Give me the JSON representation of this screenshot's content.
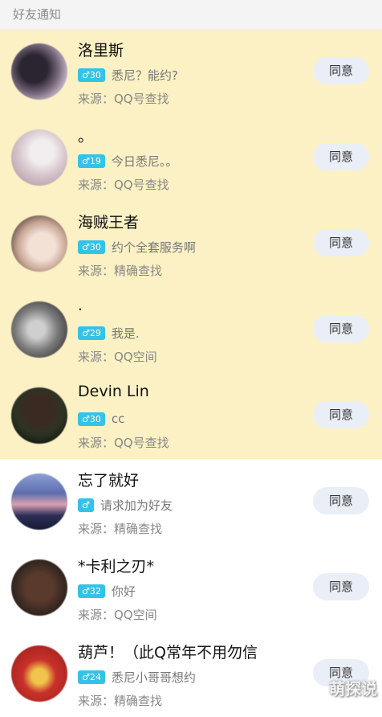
{
  "header": {
    "title": "好友通知"
  },
  "rows": [
    {
      "name": "洛里斯",
      "badge": "♂30",
      "message": "悉尼？能约?",
      "source": "来源：QQ号查找",
      "button": "同意"
    },
    {
      "name": "。",
      "badge": "♂19",
      "message": "今日悉尼。。",
      "source": "来源：QQ号查找",
      "button": "同意"
    },
    {
      "name": "海贼王者",
      "badge": "♂30",
      "message": "约个全套服务啊",
      "source": "来源：精确查找",
      "button": "同意"
    },
    {
      "name": ".",
      "badge": "♂29",
      "message": "我是.",
      "source": "来源：QQ空间",
      "button": "同意"
    },
    {
      "name": "Devin Lin",
      "badge": "♂30",
      "message": "cc",
      "source": "来源：QQ号查找",
      "button": "同意"
    },
    {
      "name": "忘了就好",
      "badge": "♂",
      "message": "请求加为好友",
      "source": "来源：精确查找",
      "button": "同意"
    },
    {
      "name": "*卡利之刃*",
      "badge": "♂32",
      "message": "你好",
      "source": "来源：QQ空间",
      "button": "同意"
    },
    {
      "name": "葫芦！（此Q常年不用勿信",
      "badge": "♂24",
      "message": "悉尼小哥哥想约",
      "source": "来源：精确查找",
      "button": "同意"
    }
  ],
  "watermark": "萌探说",
  "colors": {
    "highlight": "#fbf1c4",
    "badge": "#34c3e8",
    "button_bg": "#eaeef7",
    "header_bg": "#f4f4f4"
  }
}
